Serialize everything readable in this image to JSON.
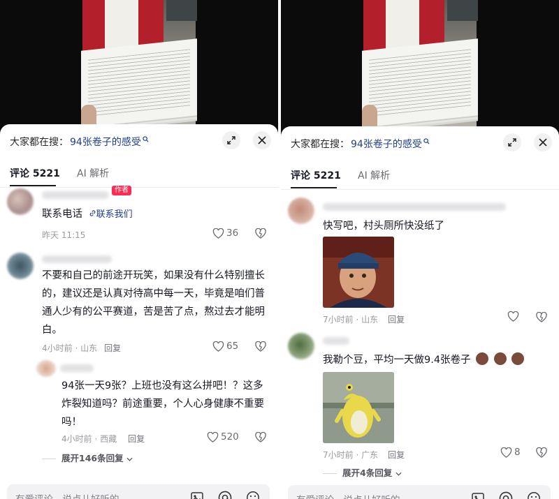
{
  "search": {
    "prefix": "大家都在搜：",
    "term": "94张卷子的感受"
  },
  "tabs": {
    "comments": "评论 5221",
    "comments_right": "评论 5221",
    "ai": "AI 解析"
  },
  "left": {
    "c1": {
      "badge": "作者",
      "text_prefix": "联系电话",
      "link": "联系我们",
      "meta": "昨天 11:15",
      "likes": "36"
    },
    "c2": {
      "text": "不要和自己的前途开玩笑，如果没有什么特别擅长的，建议还是认真对待高中每一天，毕竟是咱们普通人少有的公平赛道，苦是苦了点，熬过去才能明白。",
      "meta": "4小时前 · 山东",
      "reply": "回复",
      "likes": "65"
    },
    "c3": {
      "text": "94张一天9张？上班也没有这么拼吧！？这多炸裂知道吗？前途重要，个人心身健康不重要吗！",
      "meta": "4小时前 · 西藏",
      "reply": "回复",
      "likes": "520"
    },
    "expand": "展开146条回复"
  },
  "right": {
    "c1": {
      "text": "快写吧，村头厕所快没纸了",
      "meta": "7小时前 · 山东",
      "reply": "回复"
    },
    "c2": {
      "text": "我勒个豆，平均一天做9.4张卷子",
      "meta": "7小时前 · 广东",
      "reply": "回复",
      "likes": "8"
    },
    "expand": "展开4条回复"
  },
  "input": {
    "placeholder": "有爱评论，说点儿好听的"
  },
  "colors": {
    "accent_red": "#fe2c55",
    "link_blue": "#1f3f8a"
  }
}
